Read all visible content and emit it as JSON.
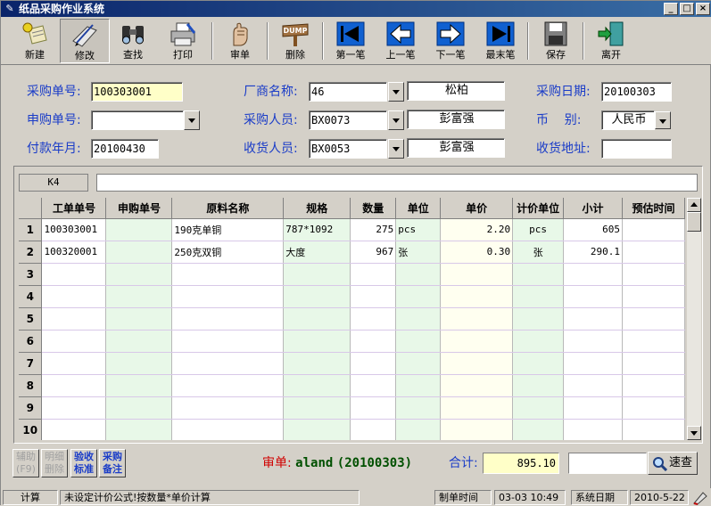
{
  "window": {
    "title": "纸品采购作业系统"
  },
  "toolbar": [
    {
      "label": "新建",
      "icon": "new-doc-icon"
    },
    {
      "label": "修改",
      "icon": "edit-pen-icon"
    },
    {
      "label": "查找",
      "icon": "binoculars-icon"
    },
    {
      "label": "打印",
      "icon": "printer-icon"
    },
    {
      "label": "审单",
      "icon": "audit-hand-icon"
    },
    {
      "label": "删除",
      "icon": "dump-icon"
    },
    {
      "label": "第一笔",
      "icon": "first-record-icon"
    },
    {
      "label": "上一笔",
      "icon": "prev-record-icon"
    },
    {
      "label": "下一笔",
      "icon": "next-record-icon"
    },
    {
      "label": "最末笔",
      "icon": "last-record-icon"
    },
    {
      "label": "保存",
      "icon": "save-disk-icon"
    },
    {
      "label": "离开",
      "icon": "exit-door-icon"
    }
  ],
  "form": {
    "purchase_no_label": "采购单号:",
    "purchase_no": "100303001",
    "vendor_label": "厂商名称:",
    "vendor_code": "46",
    "vendor_name": "松柏",
    "purchase_date_label": "采购日期:",
    "purchase_date": "20100303",
    "request_no_label": "申购单号:",
    "request_no": "",
    "buyer_label": "采购人员:",
    "buyer_code": "BX0073",
    "buyer_name": "彭富强",
    "currency_label": "币    别:",
    "currency": "人民币",
    "payment_month_label": "付款年月:",
    "payment_month": "20100430",
    "receiver_label": "收货人员:",
    "receiver_code": "BX0053",
    "receiver_name": "彭富强",
    "delivery_addr_label": "收货地址:",
    "delivery_addr": ""
  },
  "grid": {
    "cell_ref": "K4",
    "formula": "",
    "columns": [
      "工单单号",
      "申购单号",
      "原料名称",
      "规格",
      "数量",
      "单位",
      "单价",
      "计价单位",
      "小计",
      "预估时间"
    ],
    "rows": [
      {
        "no": "1",
        "cells": [
          "100303001",
          "",
          "190克单铜",
          "787*1092",
          "275",
          "pcs",
          "2.20",
          "pcs",
          "605",
          ""
        ]
      },
      {
        "no": "2",
        "cells": [
          "100320001",
          "",
          "250克双铜",
          "大度",
          "967",
          "张",
          "0.30",
          "张",
          "290.1",
          ""
        ]
      },
      {
        "no": "3",
        "cells": [
          "",
          "",
          "",
          "",
          "",
          "",
          "",
          "",
          "",
          ""
        ]
      },
      {
        "no": "4",
        "cells": [
          "",
          "",
          "",
          "",
          "",
          "",
          "",
          "",
          "",
          ""
        ]
      },
      {
        "no": "5",
        "cells": [
          "",
          "",
          "",
          "",
          "",
          "",
          "",
          "",
          "",
          ""
        ]
      },
      {
        "no": "6",
        "cells": [
          "",
          "",
          "",
          "",
          "",
          "",
          "",
          "",
          "",
          ""
        ]
      },
      {
        "no": "7",
        "cells": [
          "",
          "",
          "",
          "",
          "",
          "",
          "",
          "",
          "",
          ""
        ]
      },
      {
        "no": "8",
        "cells": [
          "",
          "",
          "",
          "",
          "",
          "",
          "",
          "",
          "",
          ""
        ]
      },
      {
        "no": "9",
        "cells": [
          "",
          "",
          "",
          "",
          "",
          "",
          "",
          "",
          "",
          ""
        ]
      },
      {
        "no": "10",
        "cells": [
          "",
          "",
          "",
          "",
          "",
          "",
          "",
          "",
          "",
          ""
        ]
      }
    ]
  },
  "bottom": {
    "assist_btn": [
      "辅助",
      "(F9)"
    ],
    "detail_delete_btn": [
      "明细",
      "删除"
    ],
    "inspect_btn": [
      "验收",
      "标准"
    ],
    "purchase_note_btn": [
      "采购",
      "备注"
    ],
    "audit_label": "审单:",
    "audit_user": "aland",
    "audit_date": "(20100303)",
    "total_label": "合计:",
    "total": "895.10",
    "quick_search_value": "",
    "quick_search_btn": "速查"
  },
  "status": {
    "calc": "计算",
    "message": "未设定计价公式!按数量*单价计算",
    "created_label": "制单时间",
    "created_time": "03-03 10:49",
    "sysdate_label": "系统日期",
    "sysdate": "2010-5-22"
  },
  "colors": {
    "label_blue": "#1a3cc8",
    "highlight_yellow": "#ffffc8",
    "audit_red": "#d00000",
    "audit_green": "#005000"
  }
}
